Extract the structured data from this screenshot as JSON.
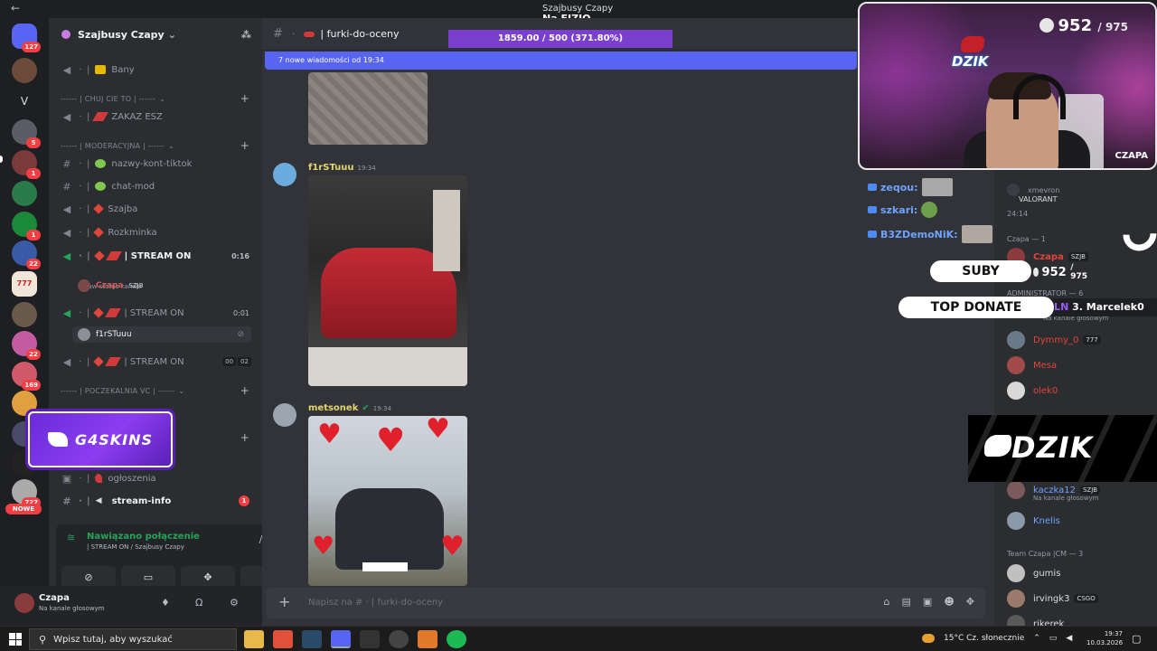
{
  "window": {
    "title": "Szajbusy Czapy",
    "subtitle": "Na FIZJO"
  },
  "server": {
    "name": "Szajbusy Czapy"
  },
  "rail": {
    "badges": [
      "127",
      "5",
      "1",
      "1",
      "22",
      "169",
      "12",
      "727"
    ],
    "nowe": "NOWE",
    "letter": "V",
    "logo777": "777"
  },
  "channels": [
    {
      "name": "Bany"
    },
    {
      "category": "------ | CHUJ CIE TO | ------"
    },
    {
      "name": "ZAKAZ ESZ"
    },
    {
      "category": "------ | MODERACYJNA | ------"
    },
    {
      "name": "nazwy-kont-tiktok"
    },
    {
      "name": "chat-mod"
    },
    {
      "name": "Szajba"
    },
    {
      "name": "Rozkminka"
    },
    {
      "name": "| STREAM ON",
      "time": "0:16",
      "note": "Ustaw status kanału"
    },
    {
      "name": "| STREAM ON",
      "time": "0:01"
    },
    {
      "name": "| STREAM ON",
      "tags": [
        "00",
        "02"
      ]
    },
    {
      "category": "------ | POCZEKALNIA VC | ------"
    },
    {
      "name": "ogłoszenia"
    },
    {
      "name": "stream-info",
      "unread": "1"
    }
  ],
  "voice_users": {
    "czapa": "Czapa",
    "czapa_tag": "SZJB",
    "f1r": "f1rSTuuu"
  },
  "promo": {
    "text": "G4SKINS"
  },
  "voice_panel": {
    "status": "Nawiązano połączenie",
    "channel": "| STREAM ON / Szajbusy Czapy"
  },
  "user_panel": {
    "name": "Czapa",
    "status": "Na kanale głosowym"
  },
  "chat": {
    "channel": "| furki-do-oceny",
    "new_messages": "7 nowe wiadomości od 19:34",
    "donate_bar": "1859.00 / 500 (371.80%)",
    "messages": [
      {
        "author": "f1rSTuuu",
        "time": "19:34",
        "color": "#e6d36b"
      },
      {
        "author": "metsonek",
        "time": "19:34",
        "color": "#e6d36b"
      }
    ],
    "composer_placeholder": "Napisz na # · | furki-do-oceny"
  },
  "stream": {
    "sub_count": "952",
    "sub_goal": "/ 975",
    "cam_label": "CZAPA",
    "cam_logo": "DZIK",
    "chat": [
      {
        "user": "zeqou:",
        "color": "#6fa3ff"
      },
      {
        "user": "szkari:",
        "color": "#6fa3ff"
      },
      {
        "user": "B3ZDemoNiK:",
        "color": "#6fa3ff"
      }
    ],
    "suby_label": "SUBY",
    "suby_count": "952",
    "suby_goal": "/ 975",
    "top_donate_label": "TOP DONATE",
    "top_donate_prefix": "PLN",
    "top_donate_entry": "3. Marcelek0",
    "banner": "DZIK"
  },
  "members": {
    "game_user": "xmevron",
    "game": "VALORANT",
    "game_time": "24:14",
    "section_czapa": "Czapa — 1",
    "czapa": "Czapa",
    "czapa_tag": "SZJB",
    "section_admin": "ADMINISTRATOR — 6",
    "na_kanale": "Na kanale głosowym",
    "dymmy": "Dymmy_0",
    "dymmy_tag": "777",
    "mesa": "Mesa",
    "olek": "olek0",
    "kaczka": "kaczka12",
    "kaczka_tag": "SZJB",
    "knelis": "Knelis",
    "section_team": "Team Czapa |CM — 3",
    "gumis": "gumis",
    "irving": "irvingk3",
    "irving_tag": "CSGO",
    "rikerek": "rikerek"
  },
  "taskbar": {
    "search": "Wpisz tutaj, aby wyszukać",
    "weather": "15°C  Cz. słonecznie",
    "time": "19:37",
    "date": "10.03.2026"
  },
  "colors": {
    "accent": "#5865f2",
    "online": "#23a55a",
    "danger": "#f23f43",
    "donate": "#7b3fd0"
  }
}
